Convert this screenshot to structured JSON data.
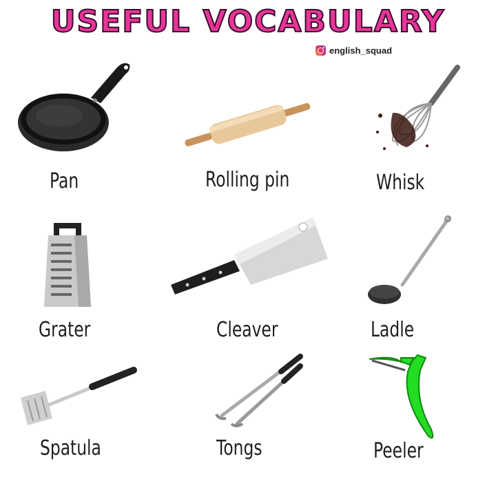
{
  "title": "USEFUL VOCABULARY",
  "handle": {
    "icon": "instagram-icon",
    "text": "english_squad"
  },
  "colors": {
    "title_fill": "#e8359a",
    "title_outline": "#3a0d2a",
    "peeler_green": "#22dd22"
  },
  "items": [
    {
      "label": "Pan",
      "icon": "pan-icon"
    },
    {
      "label": "Rolling pin",
      "icon": "rolling-pin-icon"
    },
    {
      "label": "Whisk",
      "icon": "whisk-icon"
    },
    {
      "label": "Grater",
      "icon": "grater-icon"
    },
    {
      "label": "Cleaver",
      "icon": "cleaver-icon"
    },
    {
      "label": "Ladle",
      "icon": "ladle-icon"
    },
    {
      "label": "Spatula",
      "icon": "spatula-icon"
    },
    {
      "label": "Tongs",
      "icon": "tongs-icon"
    },
    {
      "label": "Peeler",
      "icon": "peeler-icon"
    }
  ]
}
